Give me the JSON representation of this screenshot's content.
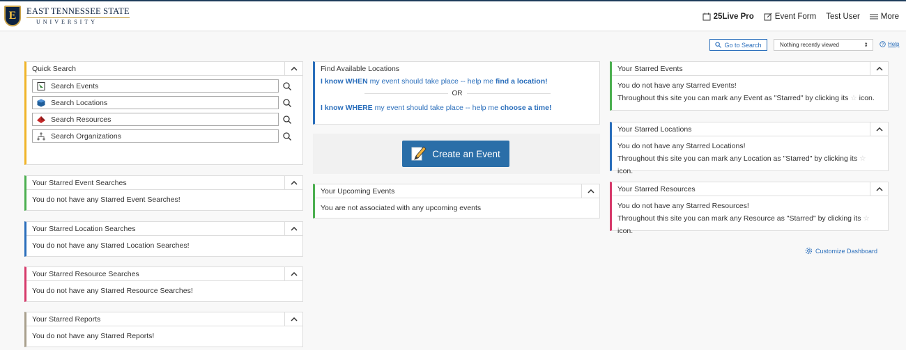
{
  "header": {
    "logo_line1": "EAST TENNESSEE STATE",
    "logo_line2": "UNIVERSITY",
    "logo_letter": "E",
    "nav": {
      "product": "25Live Pro",
      "event_form": "Event Form",
      "user": "Test User",
      "more": "More"
    }
  },
  "toolbar": {
    "go_to_search": "Go to Search",
    "recent_placeholder": "Nothing recently viewed",
    "help": "Help"
  },
  "quick_search": {
    "title": "Quick Search",
    "items": [
      {
        "label": "Search Events",
        "icon": "events-icon"
      },
      {
        "label": "Search Locations",
        "icon": "locations-cube-icon"
      },
      {
        "label": "Search Resources",
        "icon": "resources-icon"
      },
      {
        "label": "Search Organizations",
        "icon": "organizations-icon"
      }
    ]
  },
  "starred_searches": [
    {
      "title": "Your Starred Event Searches",
      "body": "You do not have any Starred Event Searches!",
      "color": "#4caf50"
    },
    {
      "title": "Your Starred Location Searches",
      "body": "You do not have any Starred Location Searches!",
      "color": "#2a6ebb"
    },
    {
      "title": "Your Starred Resource Searches",
      "body": "You do not have any Starred Resource Searches!",
      "color": "#d63a6b"
    },
    {
      "title": "Your Starred Reports",
      "body": "You do not have any Starred Reports!",
      "color": "#a89f8c"
    }
  ],
  "find_locations": {
    "title": "Find Available Locations",
    "when_prefix": "I know WHEN",
    "when_mid": " my event should take place -- help me ",
    "when_bold": "find a location!",
    "or": "OR",
    "where_prefix": "I know WHERE",
    "where_mid": " my event should take place -- help me ",
    "where_bold": "choose a time!"
  },
  "create_event": {
    "label": "Create an Event"
  },
  "upcoming": {
    "title": "Your Upcoming Events",
    "body": "You are not associated with any upcoming events"
  },
  "starred": [
    {
      "title": "Your Starred Events",
      "line1": "You do not have any Starred Events!",
      "line2": "Throughout this site you can mark any Event as \"Starred\" by clicking its",
      "suffix": "icon.",
      "color": "#4caf50"
    },
    {
      "title": "Your Starred Locations",
      "line1": "You do not have any Starred Locations!",
      "line2": "Throughout this site you can mark any Location as \"Starred\" by clicking its",
      "suffix": "icon.",
      "color": "#2a6ebb"
    },
    {
      "title": "Your Starred Resources",
      "line1": "You do not have any Starred Resources!",
      "line2": "Throughout this site you can mark any Resource as \"Starred\" by clicking its",
      "suffix": "icon.",
      "color": "#d63a6b"
    }
  ],
  "customize": "Customize Dashboard",
  "colors": {
    "quick_search": "#f0b429",
    "find_locations": "#2a6ebb",
    "upcoming": "#4caf50",
    "primary": "#2a6ea8"
  }
}
